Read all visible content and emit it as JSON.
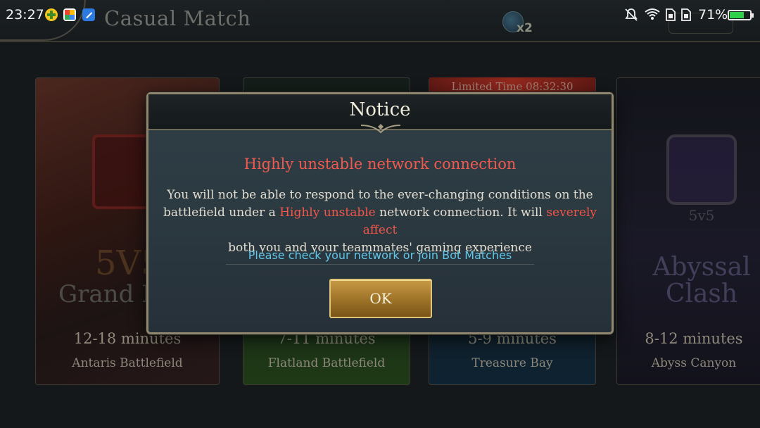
{
  "status_bar": {
    "time": "23:27",
    "battery_percent": "71%",
    "battery_level": 0.71,
    "battery_color": "#2fd14b",
    "icons": [
      "mute-icon",
      "wifi-icon",
      "sim1-icon",
      "sim2-icon"
    ]
  },
  "header": {
    "title": "Casual Match",
    "exp_multiplier": "x2",
    "help_label": ""
  },
  "cards": [
    {
      "mode": "5V5",
      "name": "Grand B",
      "duration": "12-18 minutes",
      "map": "Antaris Battlefield"
    },
    {
      "mode": "",
      "name": "",
      "duration": "7-11 minutes",
      "map": "Flatland Battlefield"
    },
    {
      "mode": "",
      "name": "",
      "duration": "5-9 minutes",
      "map": "Treasure Bay",
      "ribbon": "Limited Time  08:32:30"
    },
    {
      "mode": "5v5",
      "name_line1": "Abyssal",
      "name_line2": "Clash",
      "duration": "8-12 minutes",
      "map": "Abyss Canyon"
    }
  ],
  "dialog": {
    "title": "Notice",
    "heading": "Highly unstable network connection",
    "message_part1": "You will not be able to respond to the ever-changing conditions on the battlefield under a ",
    "message_hl1": "Highly unstable",
    "message_part2": " network connection. It will ",
    "message_hl2": "severely affect",
    "message_part3": " both you and your teammates' gaming experience",
    "hint": "Please check your network or join Bot Matches",
    "ok_label": "OK",
    "accent_color": "#f05a4e",
    "hint_color": "#62c6e8"
  }
}
